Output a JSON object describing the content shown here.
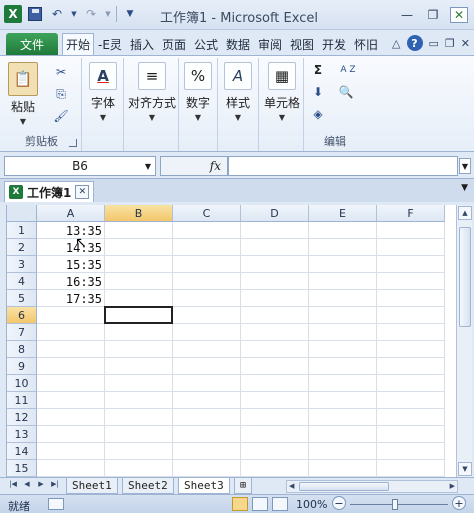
{
  "window": {
    "title": "工作簿1 - Microsoft Excel",
    "qat_separator": "|"
  },
  "ribbon_tabs": {
    "file": "文件",
    "tabs": [
      "开始",
      "-E灵",
      "插入",
      "页面",
      "公式",
      "数据",
      "审阅",
      "视图",
      "开发",
      "怀旧"
    ],
    "active_index": 0
  },
  "ribbon": {
    "clipboard": {
      "paste": "粘贴",
      "group": "剪贴板"
    },
    "font": {
      "label": "字体",
      "glyph": "A"
    },
    "alignment": {
      "label": "对齐方式"
    },
    "number": {
      "label": "数字",
      "glyph": "%"
    },
    "styles": {
      "label": "样式",
      "glyph": "A"
    },
    "cells": {
      "label": "单元格"
    },
    "editing": {
      "group": "编辑",
      "sum": "Σ",
      "sort": "A Z"
    }
  },
  "formula_bar": {
    "name_box": "B6",
    "fx": "fx",
    "value": ""
  },
  "workbook_tab": {
    "name": "工作簿1"
  },
  "grid": {
    "columns": [
      "A",
      "B",
      "C",
      "D",
      "E",
      "F"
    ],
    "rows": [
      "1",
      "2",
      "3",
      "4",
      "5",
      "6",
      "7",
      "8",
      "9",
      "10",
      "11",
      "12",
      "13",
      "14",
      "15"
    ],
    "selected_column": "B",
    "selected_row": "6",
    "cells_A": [
      "13:35",
      "14:35",
      "15:35",
      "16:35",
      "17:35"
    ]
  },
  "sheets": {
    "tabs": [
      "Sheet1",
      "Sheet2",
      "Sheet3"
    ],
    "active": "Sheet3"
  },
  "status": {
    "ready": "就绪",
    "zoom": "100%"
  }
}
